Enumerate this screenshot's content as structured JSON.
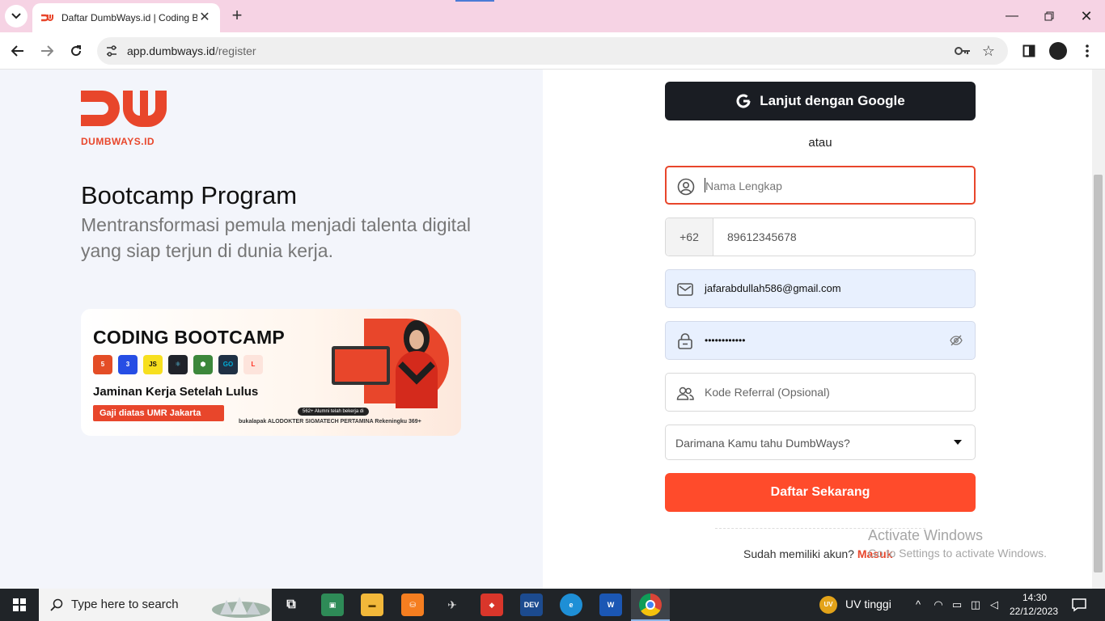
{
  "browser": {
    "tab_title": "Daftar DumbWays.id | Coding B",
    "url_host": "app.dumbways.id",
    "url_path": "/register",
    "new_tab_label": "+",
    "close_tab_label": "✕"
  },
  "hero": {
    "logo_text": "DUMBWAYS.ID",
    "title": "Bootcamp Program",
    "subtitle": "Mentransformasi pemula menjadi talenta digital yang siap terjun di dunia kerja."
  },
  "banner": {
    "title": "CODING BOOTCAMP",
    "tech": [
      "5",
      "3",
      "JS",
      "⚛",
      "⬢",
      "GO",
      "L"
    ],
    "tagline": "Jaminan Kerja Setelah Lulus",
    "salary": "Gaji diatas UMR Jakarta",
    "alumni": "562+ Alumni telah bekerja di",
    "partners": "bukalapak  ALODOKTER  SIGMATECH  PERTAMINA  Rekeningku  369+"
  },
  "form": {
    "google_label": "Lanjut dengan Google",
    "or_text": "atau",
    "name_placeholder": "Nama Lengkap",
    "phone_prefix": "+62",
    "phone_value": "89612345678",
    "email_value": "jafarabdullah586@gmail.com",
    "password_mask": "••••••••••••",
    "referral_placeholder": "Kode Referral (Opsional)",
    "source_select": "Darimana Kamu tahu DumbWays?",
    "submit_label": "Daftar Sekarang",
    "login_prompt": "Sudah memiliki akun?",
    "login_link": "Masuk"
  },
  "watermark": {
    "title": "Activate Windows",
    "subtitle": "Go to Settings to activate Windows."
  },
  "taskbar": {
    "search_placeholder": "Type here to search",
    "uv_badge": "UV",
    "uv_text": "UV tinggi",
    "time": "14:30",
    "date": "22/12/2023"
  },
  "colors": {
    "brand": "#e8462b",
    "cta": "#ff4b2b",
    "google_btn": "#1a1d23",
    "autofill": "#e8f0fe"
  }
}
